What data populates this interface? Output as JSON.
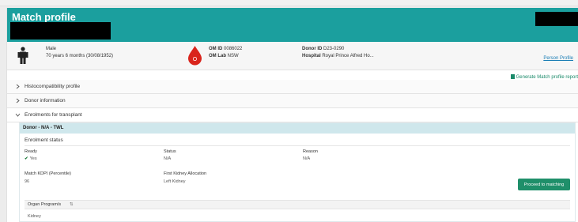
{
  "header": {
    "title": "Match profile"
  },
  "summary": {
    "sex": "Male",
    "age": "70 years 6 months (30/08/1952)",
    "blood_group_icon": "blood-drop-icon",
    "blood_group": "O",
    "om_id_label": "OM ID",
    "om_id_value": "0086022",
    "om_lab_label": "OM Lab",
    "om_lab_value": "NSW",
    "donor_id_label": "Donor ID",
    "donor_id_value": "D23-0290",
    "hospital_label": "Hospital",
    "hospital_value": "Royal Prince Alfred Ho...",
    "person_profile_link": "Person Profile"
  },
  "actions": {
    "generate_report": "Generate Match profile report"
  },
  "accordion": [
    {
      "label": "Histocompatibility profile",
      "expanded": false
    },
    {
      "label": "Donor information",
      "expanded": false
    },
    {
      "label": "Enrolments for transplant",
      "expanded": true
    }
  ],
  "enrolment": {
    "panel_title": "Donor - N/A - TWL",
    "section_title": "Enrolment status",
    "ready_label": "Ready",
    "ready_value": "Yes",
    "status_label": "Status",
    "status_value": "N/A",
    "reason_label": "Reason",
    "reason_value": "N/A",
    "kdpi_label": "Match KDPI (Percentile)",
    "kdpi_value": "96",
    "allocation_label": "First Kidney Allocation",
    "allocation_value": "Left Kidney",
    "proceed_button": "Proceed to matching",
    "table_header": "Organ Program/s",
    "table_sort_icon": "⇅",
    "table_rows": [
      "Kidney"
    ]
  },
  "colors": {
    "header_teal": "#1b9f9e",
    "panel_head": "#cfe7ec",
    "proceed_green": "#1f8f6a",
    "blood_red": "#d9241c",
    "link_blue": "#1a7db5"
  }
}
